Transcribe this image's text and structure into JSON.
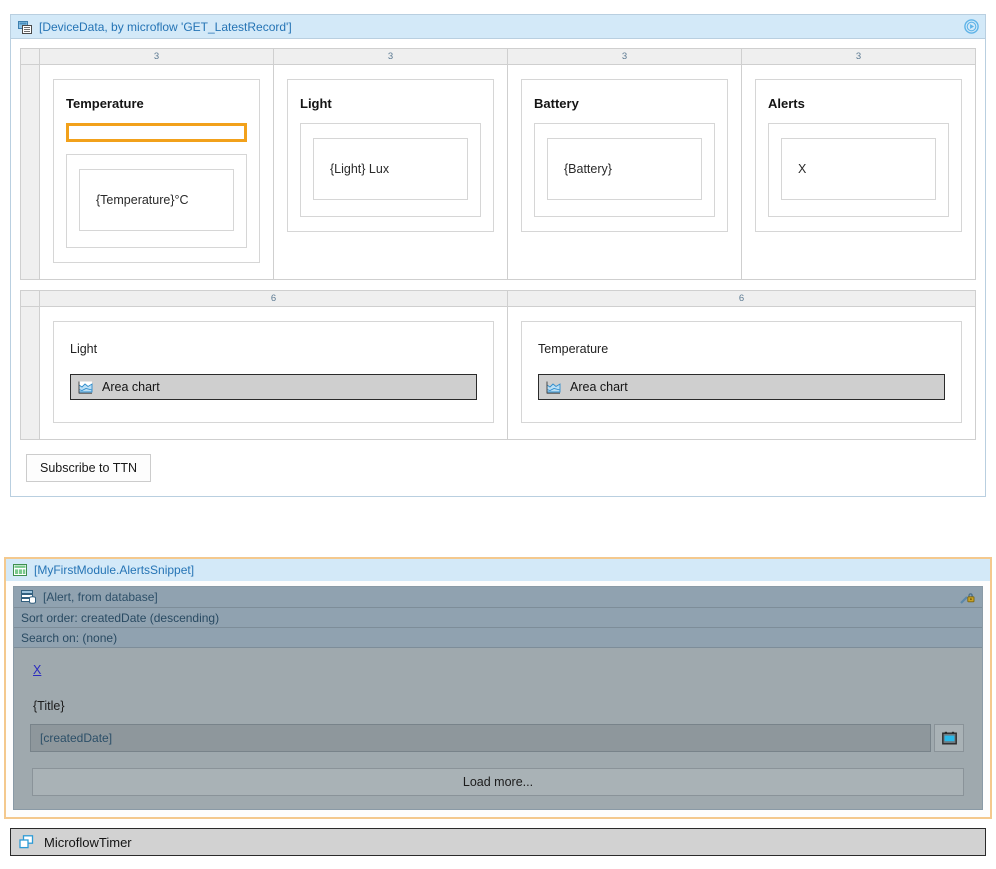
{
  "dataview": {
    "icon": "dataview-icon",
    "title": "[DeviceData, by microflow 'GET_LatestRecord']",
    "action_icon": "play-circle-icon",
    "grid1": {
      "column_headers": [
        "3",
        "3",
        "3",
        "3"
      ],
      "cards": [
        {
          "title": "Temperature",
          "selected": true,
          "value": "{Temperature}°C"
        },
        {
          "title": "Light",
          "selected": false,
          "value": "{Light} Lux"
        },
        {
          "title": "Battery",
          "selected": false,
          "value": "{Battery}"
        },
        {
          "title": "Alerts",
          "selected": false,
          "value": "X"
        }
      ]
    },
    "grid2": {
      "column_headers": [
        "6",
        "6"
      ],
      "cards": [
        {
          "title": "Light",
          "widget_label": "Area chart",
          "widget_icon": "area-chart-icon"
        },
        {
          "title": "Temperature",
          "widget_label": "Area chart",
          "widget_icon": "area-chart-icon"
        }
      ]
    },
    "subscribe_button": "Subscribe to TTN"
  },
  "snippet": {
    "icon": "snippet-icon",
    "title": "[MyFirstModule.AlertsSnippet]",
    "listview": {
      "icon": "listview-icon",
      "title": "[Alert, from database]",
      "security_icon": "lock-icon",
      "sort_order": "Sort order: createdDate (descending)",
      "search_on": "Search on: (none)",
      "item": {
        "link_label": "X",
        "title_value": "{Title}",
        "date_value": "[createdDate]",
        "date_button_icon": "calendar-icon"
      },
      "load_more": "Load more..."
    }
  },
  "microflow_timer": {
    "icon": "microflow-timer-icon",
    "label": "MicroflowTimer"
  },
  "colors": {
    "header_blue": "#d3e9f8",
    "header_text": "#2574b5",
    "selection_orange": "#f2a11b",
    "snippet_border": "#f4c98e",
    "listview_bg": "#9fa9ae",
    "listview_header": "#90a2b0"
  }
}
